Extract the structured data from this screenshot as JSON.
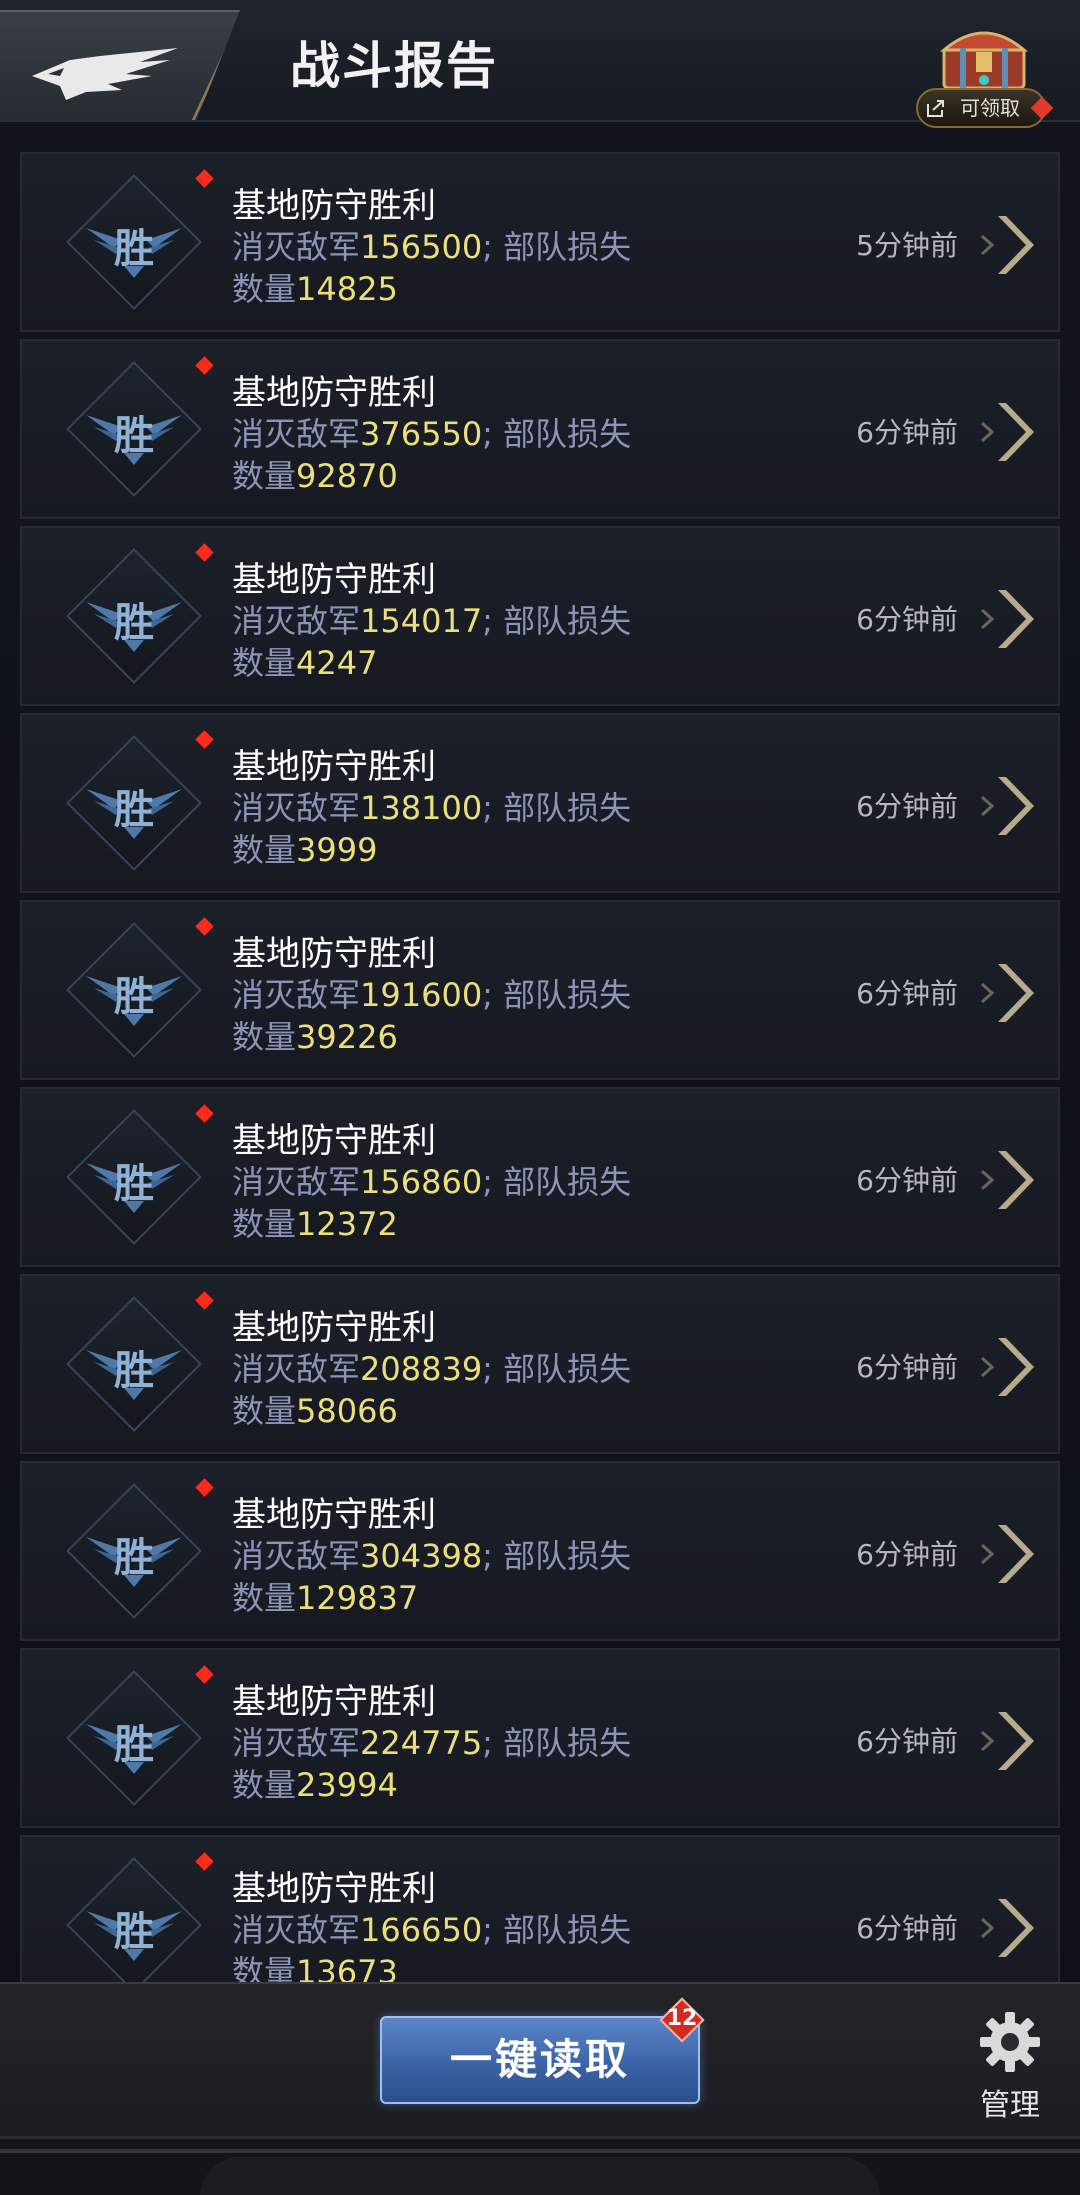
{
  "header": {
    "title": "战斗报告",
    "claim_label": "可领取"
  },
  "reports": [
    {
      "title": "基地防守胜利",
      "badge": "胜",
      "kill_prefix": "消灭敌军",
      "kill": "156500",
      "loss_prefix": "; 部队损失",
      "loss_label": "数量",
      "loss": "14825",
      "time": "5分钟前"
    },
    {
      "title": "基地防守胜利",
      "badge": "胜",
      "kill_prefix": "消灭敌军",
      "kill": "376550",
      "loss_prefix": "; 部队损失",
      "loss_label": "数量",
      "loss": "92870",
      "time": "6分钟前"
    },
    {
      "title": "基地防守胜利",
      "badge": "胜",
      "kill_prefix": "消灭敌军",
      "kill": "154017",
      "loss_prefix": "; 部队损失",
      "loss_label": "数量",
      "loss": "4247",
      "time": "6分钟前"
    },
    {
      "title": "基地防守胜利",
      "badge": "胜",
      "kill_prefix": "消灭敌军",
      "kill": "138100",
      "loss_prefix": "; 部队损失",
      "loss_label": "数量",
      "loss": "3999",
      "time": "6分钟前"
    },
    {
      "title": "基地防守胜利",
      "badge": "胜",
      "kill_prefix": "消灭敌军",
      "kill": "191600",
      "loss_prefix": "; 部队损失",
      "loss_label": "数量",
      "loss": "39226",
      "time": "6分钟前"
    },
    {
      "title": "基地防守胜利",
      "badge": "胜",
      "kill_prefix": "消灭敌军",
      "kill": "156860",
      "loss_prefix": "; 部队损失",
      "loss_label": "数量",
      "loss": "12372",
      "time": "6分钟前"
    },
    {
      "title": "基地防守胜利",
      "badge": "胜",
      "kill_prefix": "消灭敌军",
      "kill": "208839",
      "loss_prefix": "; 部队损失",
      "loss_label": "数量",
      "loss": "58066",
      "time": "6分钟前"
    },
    {
      "title": "基地防守胜利",
      "badge": "胜",
      "kill_prefix": "消灭敌军",
      "kill": "304398",
      "loss_prefix": "; 部队损失",
      "loss_label": "数量",
      "loss": "129837",
      "time": "6分钟前"
    },
    {
      "title": "基地防守胜利",
      "badge": "胜",
      "kill_prefix": "消灭敌军",
      "kill": "224775",
      "loss_prefix": "; 部队损失",
      "loss_label": "数量",
      "loss": "23994",
      "time": "6分钟前"
    },
    {
      "title": "基地防守胜利",
      "badge": "胜",
      "kill_prefix": "消灭敌军",
      "kill": "166650",
      "loss_prefix": "; 部队损失",
      "loss_label": "数量",
      "loss": "13673",
      "time": "6分钟前"
    }
  ],
  "footer": {
    "read_all_label": "一键读取",
    "unread_count": "12",
    "manage_label": "管理"
  },
  "colors": {
    "number_highlight": "#eadf7c",
    "desc_text": "#8e94b8",
    "unread_dot": "#ff2a1a",
    "button_blue": "#3c63a7"
  },
  "icons": {
    "back": "eagle-icon",
    "chest": "treasure-chest-icon",
    "share": "share-icon",
    "badge": "victory-badge-icon",
    "arrow": "chevron-right-icon",
    "manage": "gear-icon"
  }
}
